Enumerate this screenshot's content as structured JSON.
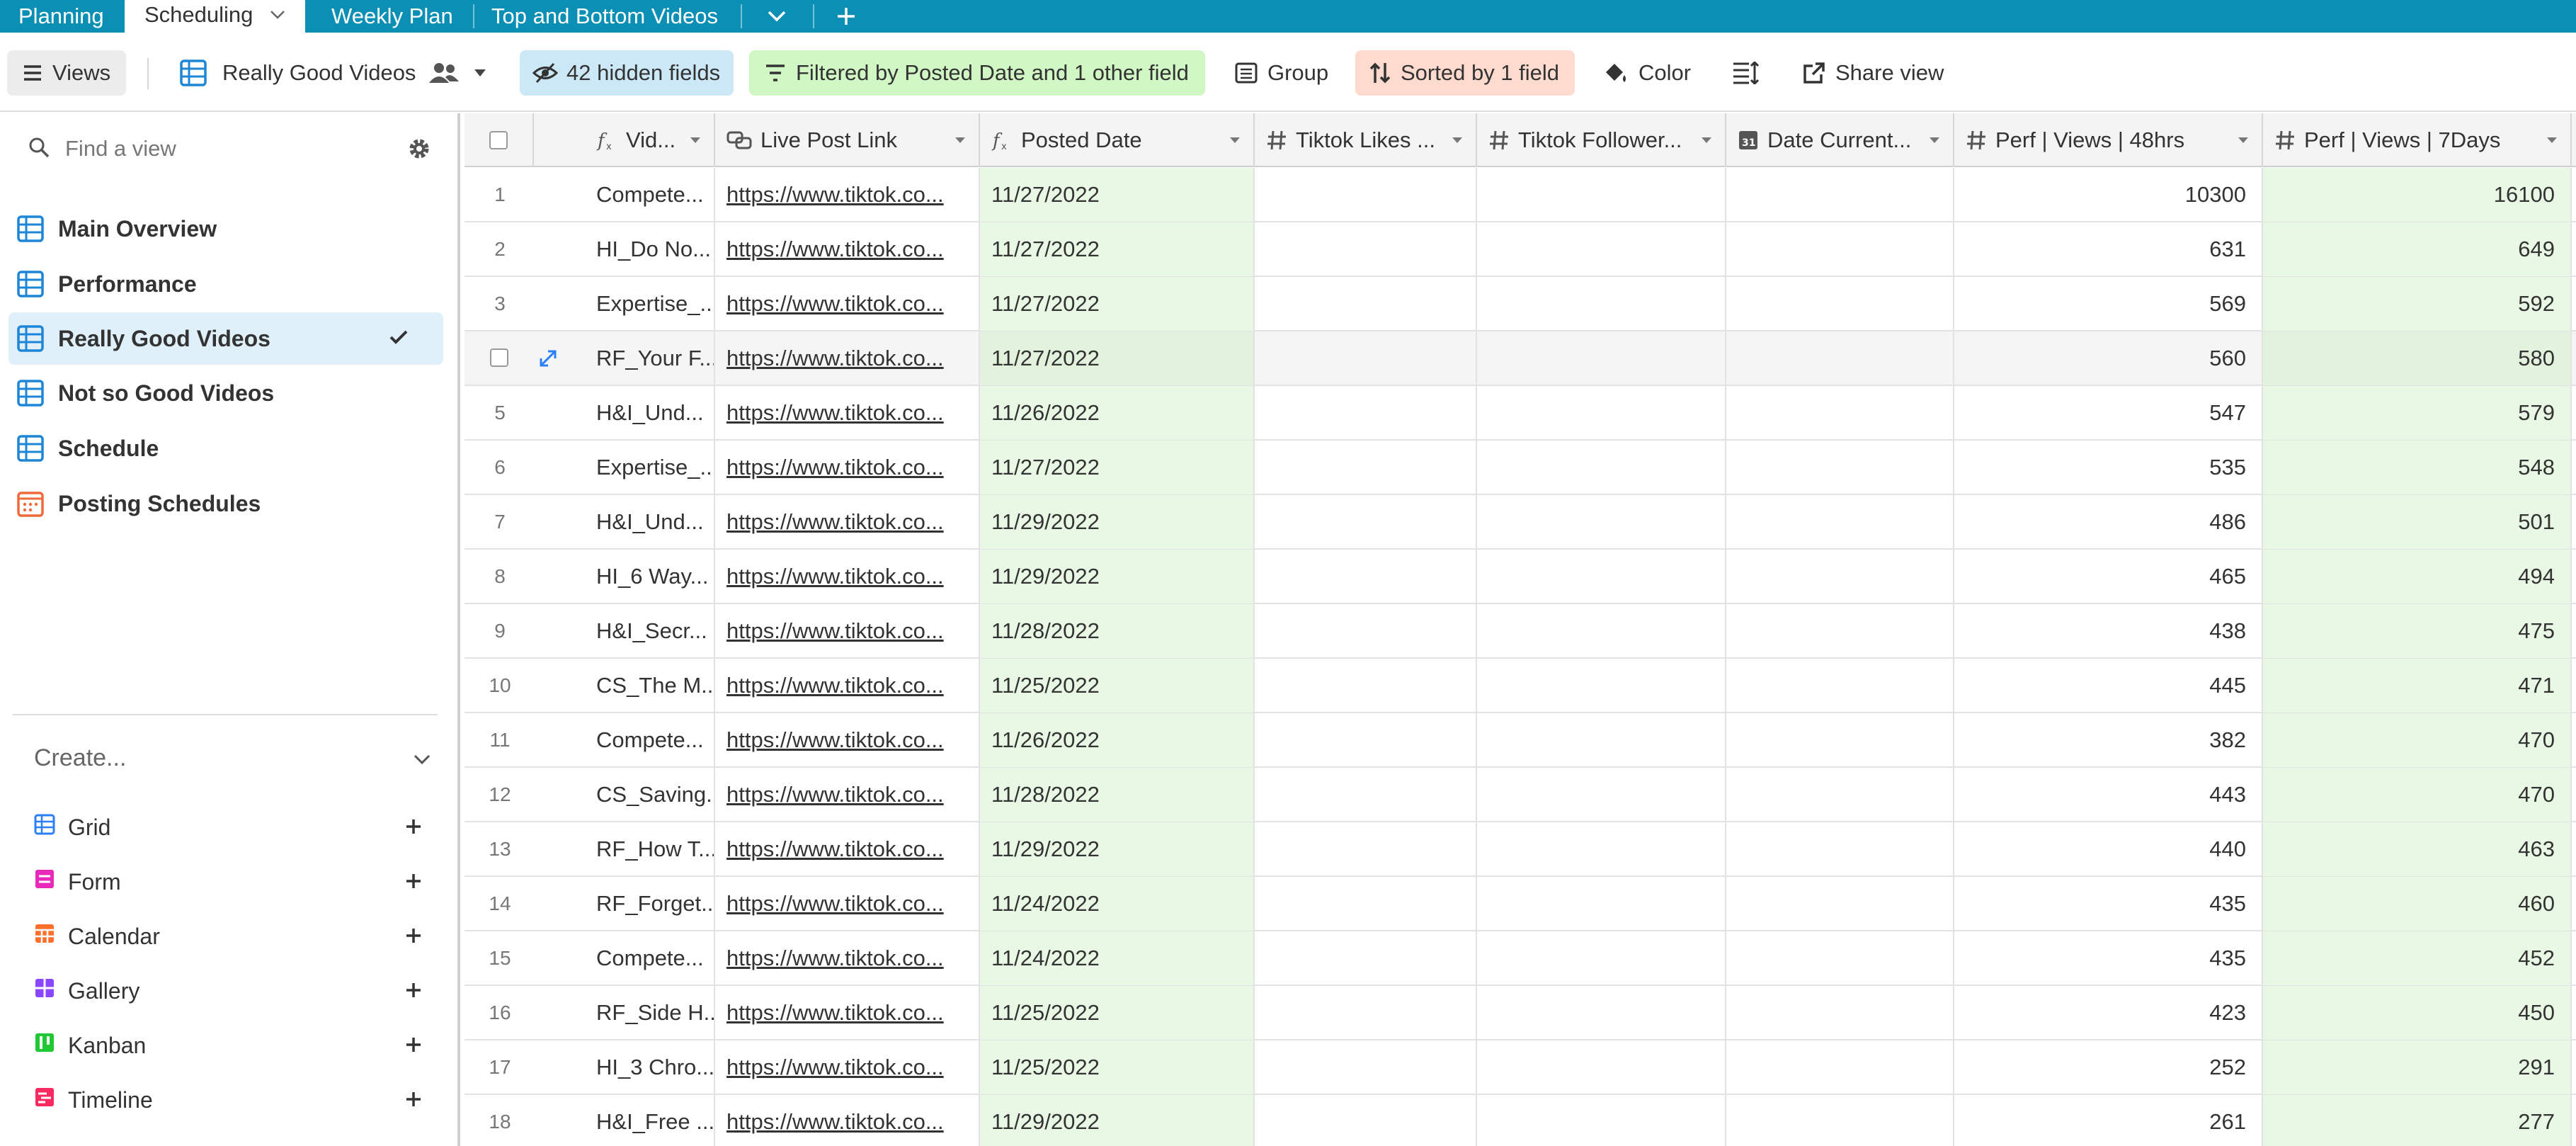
{
  "tabs": [
    "Planning",
    "Scheduling",
    "Weekly Plan",
    "Top and Bottom Videos"
  ],
  "toolbar": {
    "views_label": "Views",
    "view_name": "Really Good Videos",
    "hidden_fields": "42 hidden fields",
    "filter": "Filtered by Posted Date and 1 other field",
    "group": "Group",
    "sort": "Sorted by 1 field",
    "color": "Color",
    "share": "Share view"
  },
  "sidebar": {
    "search_placeholder": "Find a view",
    "views": [
      {
        "label": "Main Overview",
        "icon": "grid-icon"
      },
      {
        "label": "Performance",
        "icon": "grid-icon"
      },
      {
        "label": "Really Good Videos",
        "icon": "grid-icon",
        "active": true
      },
      {
        "label": "Not so Good Videos",
        "icon": "grid-icon"
      },
      {
        "label": "Schedule",
        "icon": "grid-icon"
      },
      {
        "label": "Posting Schedules",
        "icon": "calendar-icon"
      }
    ],
    "create_label": "Create...",
    "create_items": [
      {
        "label": "Grid",
        "color": "#2d7ff9"
      },
      {
        "label": "Form",
        "color": "#e929ba"
      },
      {
        "label": "Calendar",
        "color": "#ff6f2c"
      },
      {
        "label": "Gallery",
        "color": "#8b46ff"
      },
      {
        "label": "Kanban",
        "color": "#20c933"
      },
      {
        "label": "Timeline",
        "color": "#f82b60"
      }
    ]
  },
  "grid": {
    "columns": [
      {
        "label": "Vid...",
        "icon": "formula-icon"
      },
      {
        "label": "Live Post Link",
        "icon": "link-icon"
      },
      {
        "label": "Posted Date",
        "icon": "formula-icon"
      },
      {
        "label": "Tiktok Likes ...",
        "icon": "number-icon"
      },
      {
        "label": "Tiktok Follower...",
        "icon": "number-icon"
      },
      {
        "label": "Date Current...",
        "icon": "date-icon"
      },
      {
        "label": "Perf | Views | 48hrs",
        "icon": "number-icon"
      },
      {
        "label": "Perf | Views | 7Days",
        "icon": "number-icon"
      }
    ],
    "rows": [
      {
        "n": "1",
        "video": "Compete...",
        "link": "https://www.tiktok.co...",
        "date": "11/27/2022",
        "v48": "10300",
        "v7": "16100"
      },
      {
        "n": "2",
        "video": "HI_Do No...",
        "link": "https://www.tiktok.co...",
        "date": "11/27/2022",
        "v48": "631",
        "v7": "649"
      },
      {
        "n": "3",
        "video": "Expertise_...",
        "link": "https://www.tiktok.co...",
        "date": "11/27/2022",
        "v48": "569",
        "v7": "592"
      },
      {
        "n": "",
        "video": "RF_Your F...",
        "link": "https://www.tiktok.co...",
        "date": "11/27/2022",
        "v48": "560",
        "v7": "580"
      },
      {
        "n": "5",
        "video": "H&I_Und...",
        "link": "https://www.tiktok.co...",
        "date": "11/26/2022",
        "v48": "547",
        "v7": "579"
      },
      {
        "n": "6",
        "video": "Expertise_...",
        "link": "https://www.tiktok.co...",
        "date": "11/27/2022",
        "v48": "535",
        "v7": "548"
      },
      {
        "n": "7",
        "video": "H&I_Und...",
        "link": "https://www.tiktok.co...",
        "date": "11/29/2022",
        "v48": "486",
        "v7": "501"
      },
      {
        "n": "8",
        "video": "HI_6 Way...",
        "link": "https://www.tiktok.co...",
        "date": "11/29/2022",
        "v48": "465",
        "v7": "494"
      },
      {
        "n": "9",
        "video": "H&I_Secr...",
        "link": "https://www.tiktok.co...",
        "date": "11/28/2022",
        "v48": "438",
        "v7": "475"
      },
      {
        "n": "10",
        "video": "CS_The M...",
        "link": "https://www.tiktok.co...",
        "date": "11/25/2022",
        "v48": "445",
        "v7": "471"
      },
      {
        "n": "11",
        "video": "Compete...",
        "link": "https://www.tiktok.co...",
        "date": "11/26/2022",
        "v48": "382",
        "v7": "470"
      },
      {
        "n": "12",
        "video": "CS_Saving...",
        "link": "https://www.tiktok.co...",
        "date": "11/28/2022",
        "v48": "443",
        "v7": "470"
      },
      {
        "n": "13",
        "video": "RF_How T...",
        "link": "https://www.tiktok.co...",
        "date": "11/29/2022",
        "v48": "440",
        "v7": "463"
      },
      {
        "n": "14",
        "video": "RF_Forget...",
        "link": "https://www.tiktok.co...",
        "date": "11/24/2022",
        "v48": "435",
        "v7": "460"
      },
      {
        "n": "15",
        "video": "Compete...",
        "link": "https://www.tiktok.co...",
        "date": "11/24/2022",
        "v48": "435",
        "v7": "452"
      },
      {
        "n": "16",
        "video": "RF_Side H...",
        "link": "https://www.tiktok.co...",
        "date": "11/25/2022",
        "v48": "423",
        "v7": "450"
      },
      {
        "n": "17",
        "video": "HI_3 Chro...",
        "link": "https://www.tiktok.co...",
        "date": "11/25/2022",
        "v48": "252",
        "v7": "291"
      },
      {
        "n": "18",
        "video": "H&I_Free ...",
        "link": "https://www.tiktok.co...",
        "date": "11/29/2022",
        "v48": "261",
        "v7": "277"
      }
    ]
  },
  "colors": {
    "tabbar": "#0b8fb5",
    "hidden_fields_bg": "#cce8f7",
    "filter_bg": "#d1f7c4",
    "sort_bg": "#ffdace",
    "active_view_bg": "#dff0fb",
    "highlight_column": "#e9f8e4",
    "grid_icon": "#1d86d6",
    "calendar_icon": "#f06a3c"
  }
}
